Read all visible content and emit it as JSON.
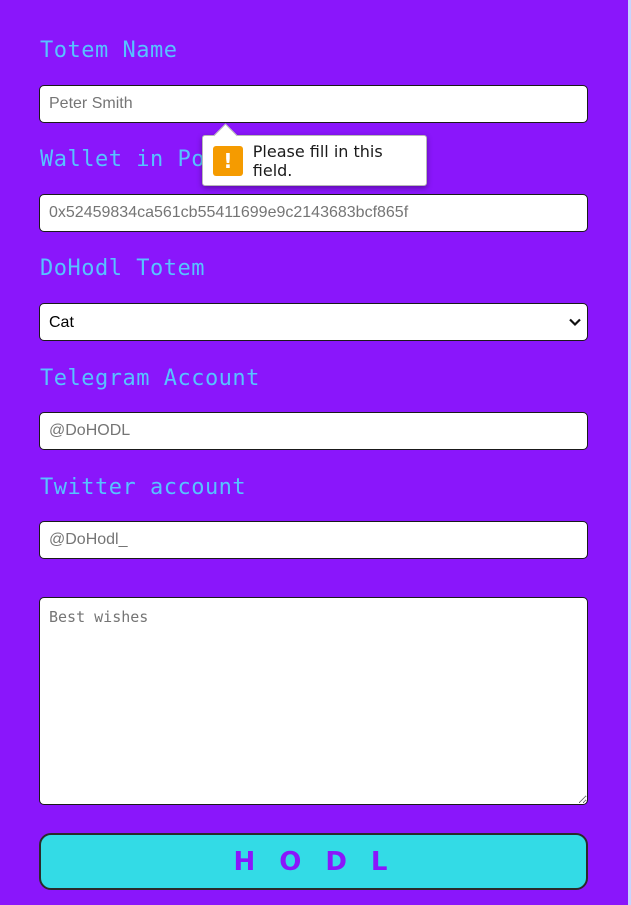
{
  "form": {
    "totem_name": {
      "label": "Totem Name",
      "value": "",
      "placeholder": "Peter Smith"
    },
    "wallet": {
      "label": "Wallet in Po",
      "value": "",
      "placeholder": "0x52459834ca561cb55411699e9c2143683bcf865f"
    },
    "totem": {
      "label": "DoHodl Totem",
      "selected": "Cat",
      "options": [
        "Cat"
      ]
    },
    "telegram": {
      "label": "Telegram Account",
      "value": "",
      "placeholder": "@DoHODL"
    },
    "twitter": {
      "label": "Twitter account",
      "value": "",
      "placeholder": "@DoHodl_"
    },
    "wishes": {
      "value": "",
      "placeholder": "Best wishes"
    },
    "submit_label": "HODL"
  },
  "tooltip": {
    "text": "Please fill in this field.",
    "icon": "warning-icon",
    "icon_glyph": "!"
  },
  "colors": {
    "background": "#8a16fb",
    "label": "#57c3ff",
    "button": "#33dbe6",
    "button_text": "#8a16fb",
    "warning": "#f59b00"
  }
}
